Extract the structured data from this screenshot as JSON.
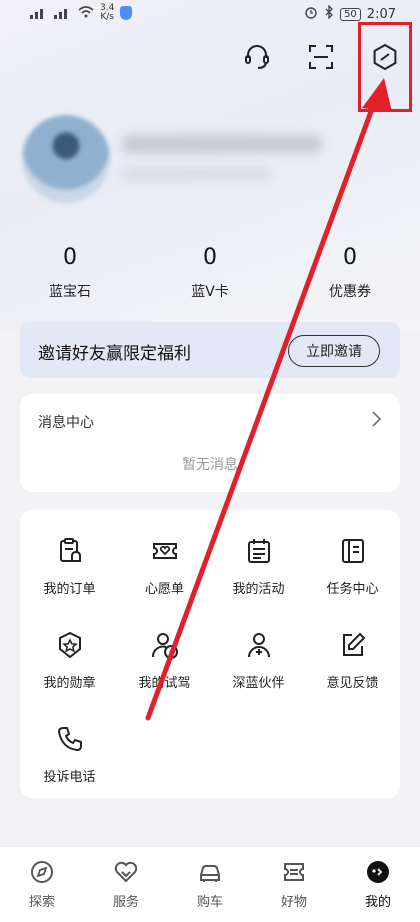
{
  "status_bar": {
    "speed_value": "3.4",
    "speed_unit": "K/s",
    "battery": "50",
    "time": "2:07"
  },
  "stats": [
    {
      "value": "0",
      "label": "蓝宝石"
    },
    {
      "value": "0",
      "label": "蓝V卡"
    },
    {
      "value": "0",
      "label": "优惠券"
    }
  ],
  "invite": {
    "title": "邀请好友赢限定福利",
    "button": "立即邀请"
  },
  "messages": {
    "title": "消息中心",
    "empty": "暂无消息"
  },
  "grid": [
    {
      "label": "我的订单",
      "icon": "order-icon"
    },
    {
      "label": "心愿单",
      "icon": "wishlist-icon"
    },
    {
      "label": "我的活动",
      "icon": "activity-icon"
    },
    {
      "label": "任务中心",
      "icon": "task-icon"
    },
    {
      "label": "我的勋章",
      "icon": "medal-icon"
    },
    {
      "label": "我的试驾",
      "icon": "test-drive-icon"
    },
    {
      "label": "深蓝伙伴",
      "icon": "partner-icon"
    },
    {
      "label": "意见反馈",
      "icon": "feedback-icon"
    },
    {
      "label": "投诉电话",
      "icon": "phone-icon"
    }
  ],
  "tabs": [
    {
      "label": "探索",
      "icon": "compass-icon"
    },
    {
      "label": "服务",
      "icon": "service-icon"
    },
    {
      "label": "购车",
      "icon": "car-icon"
    },
    {
      "label": "好物",
      "icon": "ticket-icon"
    },
    {
      "label": "我的",
      "icon": "profile-icon",
      "active": true
    }
  ],
  "colors": {
    "annotation_red": "#e1202a",
    "invite_bg": "#e2e8f6",
    "text_dark": "#222222"
  }
}
